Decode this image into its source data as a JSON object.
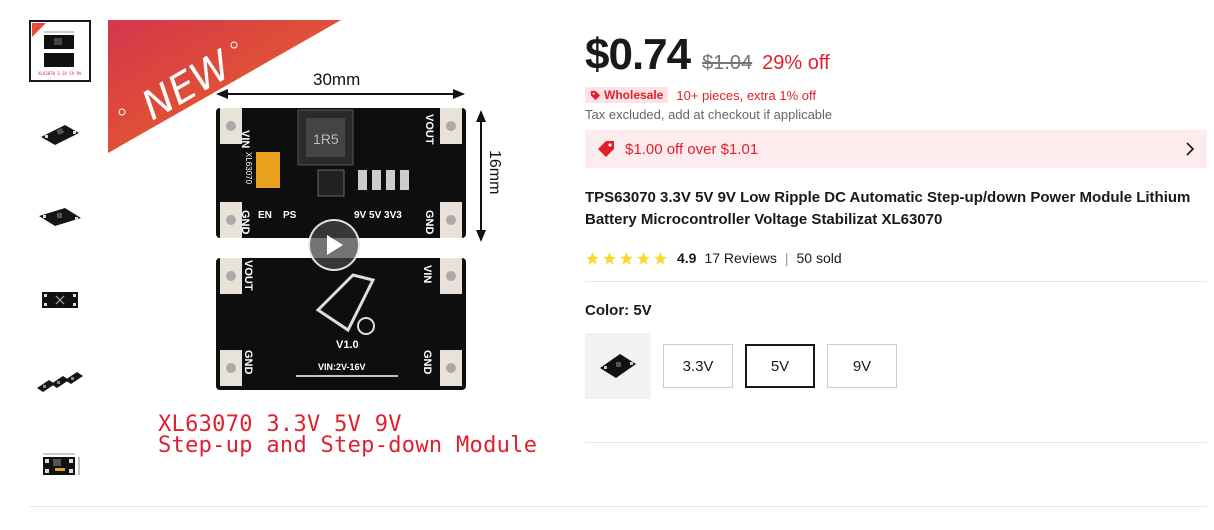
{
  "thumbnails": [
    {
      "icon": "board-dimensions-thumb",
      "active": true
    },
    {
      "icon": "module-angle-thumb"
    },
    {
      "icon": "module-side-thumb"
    },
    {
      "icon": "module-top-thumb"
    },
    {
      "icon": "module-three-thumb"
    },
    {
      "icon": "module-dimension-thumb"
    }
  ],
  "gallery": {
    "new_badge": "NEW",
    "dim_width": "30mm",
    "dim_height": "16mm",
    "board_top_labels": [
      "VIN",
      "VOUT",
      "GND",
      "GND",
      "EN",
      "PS",
      "ADJ",
      "9V",
      "5V",
      "3V3",
      "XL63070",
      "1R5"
    ],
    "board_bottom_labels": [
      "VOUT",
      "VIN",
      "GND",
      "GND",
      "V1.0",
      "VIN:2V-16V"
    ],
    "caption_line1": "XL63070 3.3V 5V 9V",
    "caption_line2": "Step-up and Step-down Module",
    "play_icon": "play-icon"
  },
  "price": {
    "current": "$0.74",
    "original": "$1.04",
    "discount": "29% off"
  },
  "wholesale": {
    "badge": "Wholesale",
    "text": "10+ pieces, extra 1% off"
  },
  "tax_note": "Tax excluded, add at checkout if applicable",
  "coupon": {
    "text": "$1.00 off over $1.01"
  },
  "product": {
    "title": "TPS63070 3.3V 5V 9V Low Ripple DC Automatic Step-up/down Power Module Lithium Battery Microcontroller Voltage Stabilizat XL63070"
  },
  "rating": {
    "score": "4.9",
    "reviews": "17 Reviews",
    "separator": "|",
    "sold": "50 sold",
    "stars": 5
  },
  "color": {
    "label": "Color: 5V",
    "options": [
      "3.3V",
      "5V",
      "9V"
    ],
    "selected": "5V"
  },
  "colors": {
    "accent": "#e0202f",
    "star": "#fdd835",
    "text": "#191919"
  }
}
